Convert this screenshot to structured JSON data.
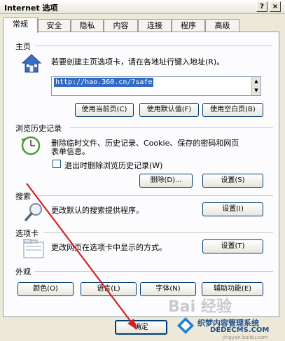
{
  "window": {
    "title": "Internet 选项",
    "help_button": "?",
    "close_button": "×"
  },
  "tabs": [
    "常规",
    "安全",
    "隐私",
    "内容",
    "连接",
    "程序",
    "高级"
  ],
  "home": {
    "group_label": "主页",
    "description": "若要创建主页选项卡，请在各地址行键入地址(R)。",
    "url": "http://hao.360.cn/?safe",
    "buttons": [
      "使用当前页(C)",
      "使用默认值(F)",
      "使用空白页(B)"
    ]
  },
  "history": {
    "group_label": "浏览历史记录",
    "description_line1": "删除临时文件、历史记录、Cookie、保存的密码和网页",
    "description_line2": "表单信息。",
    "checkbox_label": "退出时删除浏览历史记录(W)",
    "delete_button": "删除(D)...",
    "settings_button": "设置(S)"
  },
  "search": {
    "group_label": "搜索",
    "description": "更改默认的搜索提供程序。",
    "settings_button": "设置(I)"
  },
  "tabs_group": {
    "group_label": "选项卡",
    "description": "更改网页在选项卡中显示的方式。",
    "settings_button": "设置(T)"
  },
  "appearance": {
    "group_label": "外观",
    "buttons": [
      "颜色(O)",
      "语言(L)",
      "字体(N)",
      "辅助功能(E)"
    ]
  },
  "footer": {
    "ok_button": "确定"
  },
  "watermark": {
    "baidu": "Bai 经验",
    "brand": "织梦内容管理系统",
    "url": "DEDECMS.COM",
    "small": "jingyan.baidu.com"
  },
  "colors": {
    "arrow": "#d42020",
    "accent": "#316ac5"
  }
}
